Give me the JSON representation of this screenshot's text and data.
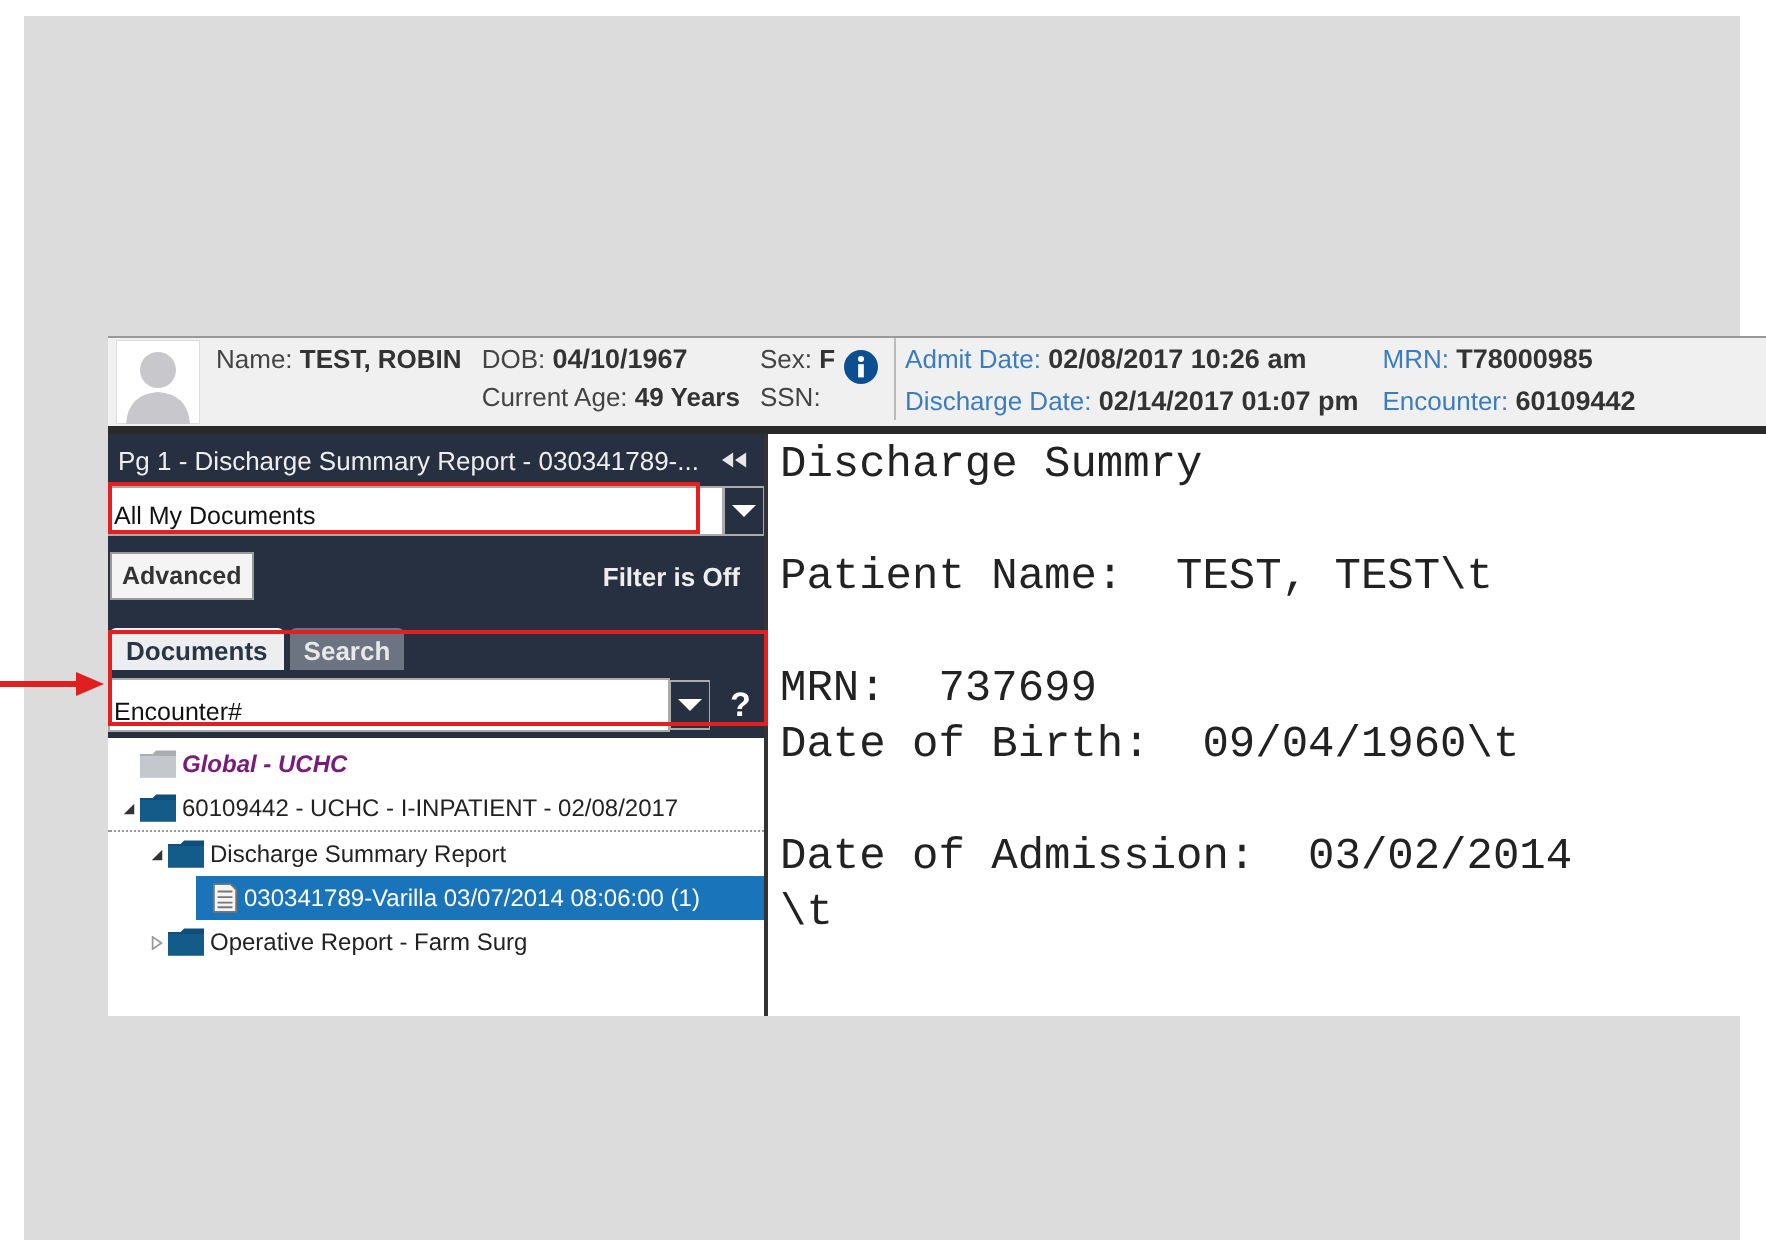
{
  "header": {
    "name": {
      "label": "Name:",
      "value": "TEST, ROBIN"
    },
    "dob": {
      "label": "DOB:",
      "value": "04/10/1967"
    },
    "current_age": {
      "label": "Current Age:",
      "value": "49 Years"
    },
    "sex": {
      "label": "Sex:",
      "value": "F"
    },
    "ssn": {
      "label": "SSN:"
    },
    "admit_date": {
      "label": "Admit Date:",
      "value": "02/08/2017 10:26 am"
    },
    "discharge_date": {
      "label": "Discharge Date:",
      "value": "02/14/2017 01:07 pm"
    },
    "mrn": {
      "label": "MRN:",
      "value": "T78000985"
    },
    "encounter": {
      "label": "Encounter:",
      "value": "60109442"
    }
  },
  "sidebar": {
    "title": "Pg 1 - Discharge Summary Report - 030341789-...",
    "document_filter": {
      "value": "All My Documents"
    },
    "advanced_button": "Advanced",
    "filter_status": "Filter is Off",
    "tabs": [
      {
        "label": "Documents",
        "selected": true
      },
      {
        "label": "Search",
        "selected": false
      }
    ],
    "group_by": {
      "value": "Encounter#"
    },
    "help": "?",
    "tree": [
      {
        "kind": "global",
        "label": "Global - UCHC",
        "selected": false
      },
      {
        "kind": "folder",
        "label": "60109442 - UCHC - I-INPATIENT - 02/08/2017",
        "expanded": true,
        "selected": false,
        "children": [
          {
            "kind": "folder",
            "label": "Discharge Summary Report",
            "expanded": true,
            "selected": false,
            "children": [
              {
                "kind": "document",
                "label": "030341789-Varilla 03/07/2014 08:06:00 (1)",
                "selected": true
              }
            ]
          },
          {
            "kind": "folder",
            "label": "Operative Report - Farm Surg",
            "expanded": false,
            "selected": false
          }
        ]
      }
    ]
  },
  "document": {
    "paragraphs": [
      [
        "Discharge Summry"
      ],
      [
        "Patient Name:  TEST, TEST\\t"
      ],
      [
        "MRN:  737699",
        "Date of Birth:  09/04/1960\\t"
      ],
      [
        "Date of Admission:  03/02/2014",
        "\\t"
      ]
    ]
  }
}
